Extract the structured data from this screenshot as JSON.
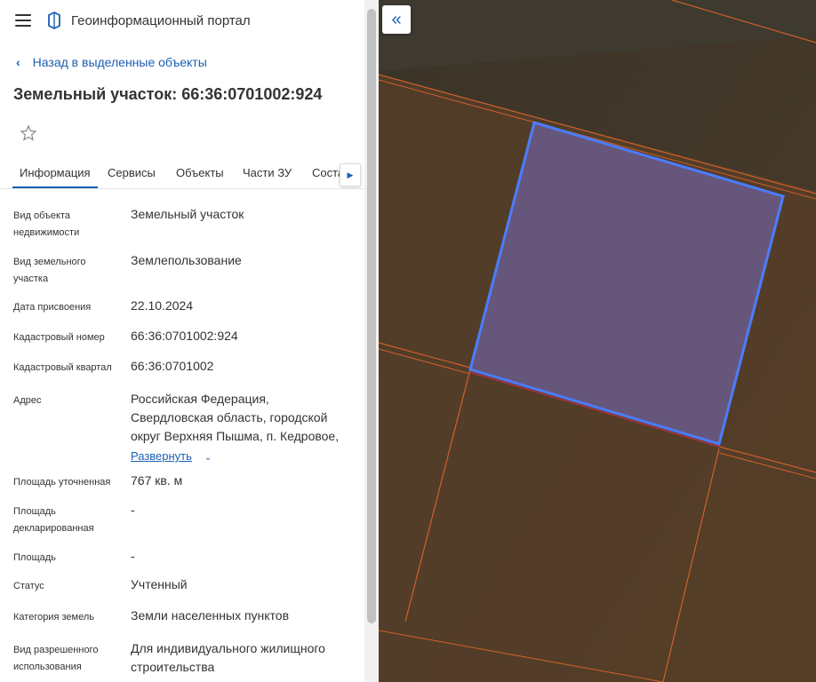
{
  "header": {
    "title": "Геоинформационный портал"
  },
  "nav": {
    "back_label": "Назад в выделенные объекты"
  },
  "object": {
    "title": "Земельный участок: 66:36:0701002:924"
  },
  "tabs": [
    {
      "label": "Информация"
    },
    {
      "label": "Сервисы"
    },
    {
      "label": "Объекты"
    },
    {
      "label": "Части ЗУ"
    },
    {
      "label": "Соста"
    }
  ],
  "info": [
    {
      "label": "Вид объекта недвижимости",
      "value": "Земельный участок"
    },
    {
      "label": "Вид земельного участка",
      "value": "Землепользование"
    },
    {
      "label": "Дата присвоения",
      "value": "22.10.2024"
    },
    {
      "label": "Кадастровый номер",
      "value": "66:36:0701002:924"
    },
    {
      "label": "Кадастровый квартал",
      "value": "66:36:0701002"
    },
    {
      "label": "Адрес",
      "value": "Российская Федерация, Свердловская область, городской округ Верхняя Пышма, п. Кедровое,",
      "expand_label": "Развернуть"
    },
    {
      "label": "Площадь уточненная",
      "value": "767 кв. м"
    },
    {
      "label": "Площадь декларированная",
      "value": "-"
    },
    {
      "label": "Площадь",
      "value": "-"
    },
    {
      "label": "Статус",
      "value": "Учтенный"
    },
    {
      "label": "Категория земель",
      "value": "Земли населенных пунктов"
    },
    {
      "label": "Вид разрешенного использования",
      "value": "Для индивидуального жилищного строительства"
    }
  ],
  "icons": {
    "menu": "menu-icon",
    "logo": "map-logo-icon",
    "back": "chevron-left-icon",
    "favorite": "star-icon",
    "tab_scroll": "chevron-right-icon",
    "expand": "chevron-down-icon",
    "collapse": "double-chevron-left-icon"
  },
  "colors": {
    "accent": "#1a5fb4",
    "selected_parcel_outline": "#4a7dff",
    "parcel_lines": "#e0652a"
  }
}
